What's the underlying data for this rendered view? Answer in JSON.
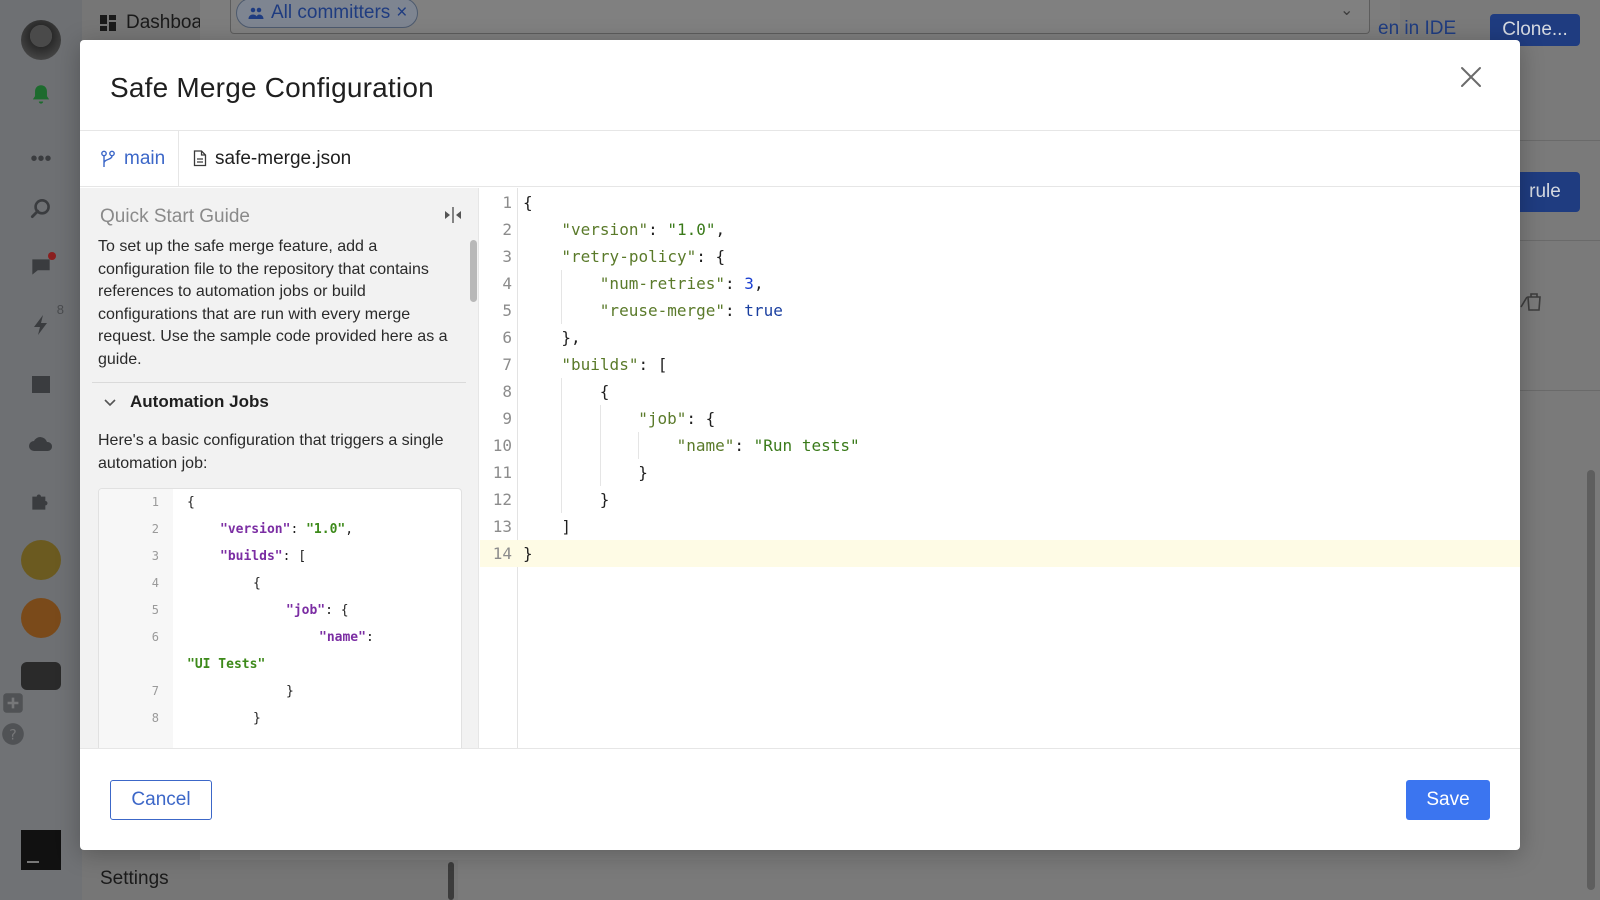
{
  "background": {
    "nav_top_label": "Dashboa",
    "nav_settings_label": "Settings",
    "filter_chip_label": "All committers",
    "open_in_ide_label": "en in IDE",
    "clone_label": "Clone...",
    "add_rule_label": "rule",
    "rail_badge_count": "8"
  },
  "modal": {
    "title": "Safe Merge Configuration",
    "branch": "main",
    "file_name": "safe-merge.json",
    "guide": {
      "title": "Quick Start Guide",
      "intro": "To set up the safe merge feature, add a configuration file to the repository that contains references to automation jobs or build configurations that are run with every merge request. Use the sample code provided here as a guide.",
      "section_title": "Automation Jobs",
      "section_text": "Here's a basic configuration that triggers a single automation job:",
      "sample_lines": [
        {
          "ln": "1",
          "indent": 0,
          "parts": [
            {
              "t": "{",
              "c": ""
            }
          ]
        },
        {
          "ln": "2",
          "indent": 1,
          "parts": [
            {
              "t": "\"version\"",
              "c": "sk"
            },
            {
              "t": ": ",
              "c": ""
            },
            {
              "t": "\"1.0\"",
              "c": "ss"
            },
            {
              "t": ",",
              "c": ""
            }
          ]
        },
        {
          "ln": "3",
          "indent": 1,
          "parts": [
            {
              "t": "\"builds\"",
              "c": "sk"
            },
            {
              "t": ": [",
              "c": ""
            }
          ]
        },
        {
          "ln": "4",
          "indent": 2,
          "parts": [
            {
              "t": "{",
              "c": ""
            }
          ]
        },
        {
          "ln": "5",
          "indent": 3,
          "parts": [
            {
              "t": "\"job\"",
              "c": "sk"
            },
            {
              "t": ": {",
              "c": ""
            }
          ]
        },
        {
          "ln": "6",
          "indent": 4,
          "parts": [
            {
              "t": "\"name\"",
              "c": "sk"
            },
            {
              "t": ":",
              "c": ""
            }
          ]
        },
        {
          "ln": "",
          "indent": 0,
          "parts": [
            {
              "t": "\"UI Tests\"",
              "c": "ss"
            }
          ]
        },
        {
          "ln": "7",
          "indent": 3,
          "parts": [
            {
              "t": "}",
              "c": ""
            }
          ]
        },
        {
          "ln": "8",
          "indent": 2,
          "parts": [
            {
              "t": "}",
              "c": ""
            }
          ]
        }
      ]
    },
    "editor_lines": [
      {
        "ln": "1",
        "indent": 0,
        "parts": [
          {
            "t": "{",
            "c": ""
          }
        ]
      },
      {
        "ln": "2",
        "indent": 1,
        "parts": [
          {
            "t": "\"version\"",
            "c": "k"
          },
          {
            "t": ": ",
            "c": ""
          },
          {
            "t": "\"1.0\"",
            "c": "s"
          },
          {
            "t": ",",
            "c": ""
          }
        ]
      },
      {
        "ln": "3",
        "indent": 1,
        "parts": [
          {
            "t": "\"retry-policy\"",
            "c": "k"
          },
          {
            "t": ": {",
            "c": ""
          }
        ]
      },
      {
        "ln": "4",
        "indent": 2,
        "parts": [
          {
            "t": "\"num-retries\"",
            "c": "k"
          },
          {
            "t": ": ",
            "c": ""
          },
          {
            "t": "3",
            "c": "n"
          },
          {
            "t": ",",
            "c": ""
          }
        ]
      },
      {
        "ln": "5",
        "indent": 2,
        "parts": [
          {
            "t": "\"reuse-merge\"",
            "c": "k"
          },
          {
            "t": ": ",
            "c": ""
          },
          {
            "t": "true",
            "c": "b"
          }
        ]
      },
      {
        "ln": "6",
        "indent": 1,
        "parts": [
          {
            "t": "},",
            "c": ""
          }
        ]
      },
      {
        "ln": "7",
        "indent": 1,
        "parts": [
          {
            "t": "\"builds\"",
            "c": "k"
          },
          {
            "t": ": [",
            "c": ""
          }
        ]
      },
      {
        "ln": "8",
        "indent": 2,
        "parts": [
          {
            "t": "{",
            "c": ""
          }
        ]
      },
      {
        "ln": "9",
        "indent": 3,
        "parts": [
          {
            "t": "\"job\"",
            "c": "k"
          },
          {
            "t": ": {",
            "c": ""
          }
        ]
      },
      {
        "ln": "10",
        "indent": 4,
        "parts": [
          {
            "t": "\"name\"",
            "c": "k"
          },
          {
            "t": ": ",
            "c": ""
          },
          {
            "t": "\"Run tests\"",
            "c": "s"
          }
        ]
      },
      {
        "ln": "11",
        "indent": 3,
        "parts": [
          {
            "t": "}",
            "c": ""
          }
        ]
      },
      {
        "ln": "12",
        "indent": 2,
        "parts": [
          {
            "t": "}",
            "c": ""
          }
        ]
      },
      {
        "ln": "13",
        "indent": 1,
        "parts": [
          {
            "t": "]",
            "c": ""
          }
        ]
      },
      {
        "ln": "14",
        "indent": 0,
        "parts": [
          {
            "t": "}",
            "c": ""
          }
        ],
        "active": true
      }
    ],
    "cancel_label": "Cancel",
    "save_label": "Save"
  },
  "colors": {
    "primary": "#3b75f0",
    "link": "#3c67c8",
    "active_line": "#fefbe5"
  }
}
